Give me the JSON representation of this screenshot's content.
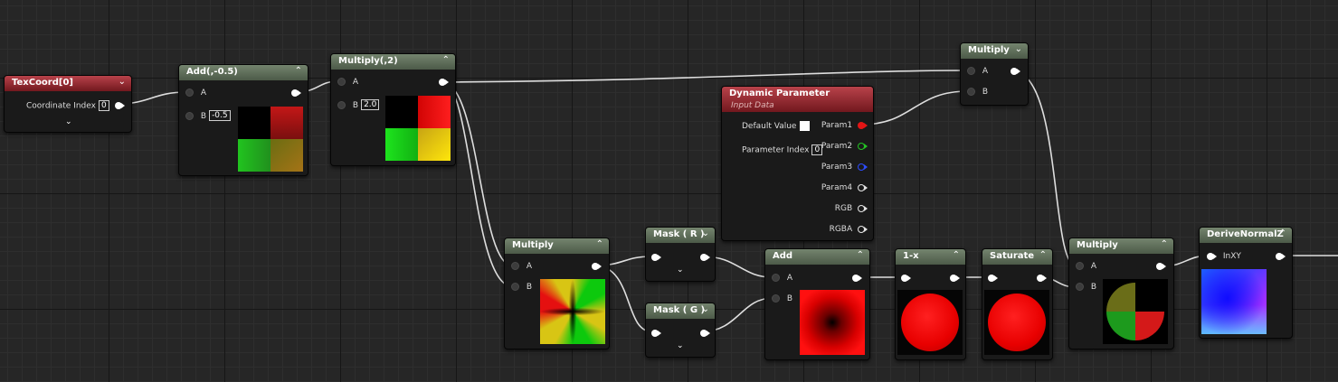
{
  "nodes": {
    "texcoord": {
      "title": "TexCoord[0]",
      "param_label": "Coordinate Index",
      "param_value": "0"
    },
    "add_neg": {
      "title": "Add(,-0.5)",
      "in_a": "A",
      "in_b": "B",
      "b_value": "-0.5"
    },
    "mul_two": {
      "title": "Multiply(,2)",
      "in_a": "A",
      "in_b": "B",
      "b_value": "2.0"
    },
    "dyn_param": {
      "title": "Dynamic Parameter",
      "subtitle": "Input Data",
      "default_label": "Default Value",
      "index_label": "Parameter Index",
      "index_value": "0",
      "outputs": [
        "Param1",
        "Param2",
        "Param3",
        "Param4",
        "RGB",
        "RGBA"
      ]
    },
    "mul_top": {
      "title": "Multiply",
      "in_a": "A",
      "in_b": "B"
    },
    "mul_sq": {
      "title": "Multiply",
      "in_a": "A",
      "in_b": "B"
    },
    "mask_r": {
      "title": "Mask ( R )"
    },
    "mask_g": {
      "title": "Mask ( G )"
    },
    "add": {
      "title": "Add",
      "in_a": "A",
      "in_b": "B"
    },
    "one_minus": {
      "title": "1-x"
    },
    "saturate": {
      "title": "Saturate"
    },
    "mul_ball": {
      "title": "Multiply",
      "in_a": "A",
      "in_b": "B"
    },
    "derive": {
      "title": "DeriveNormalZ",
      "in_label": "InXY"
    }
  },
  "colors": {
    "header_green": "#5d6b58",
    "header_red": "#9a2a30",
    "node_body": "#1a1a1a",
    "wire": "#dedede",
    "grid_bg": "#262626"
  },
  "icons": {
    "collapse": "chevron-up-icon",
    "expand": "chevron-down-icon"
  }
}
